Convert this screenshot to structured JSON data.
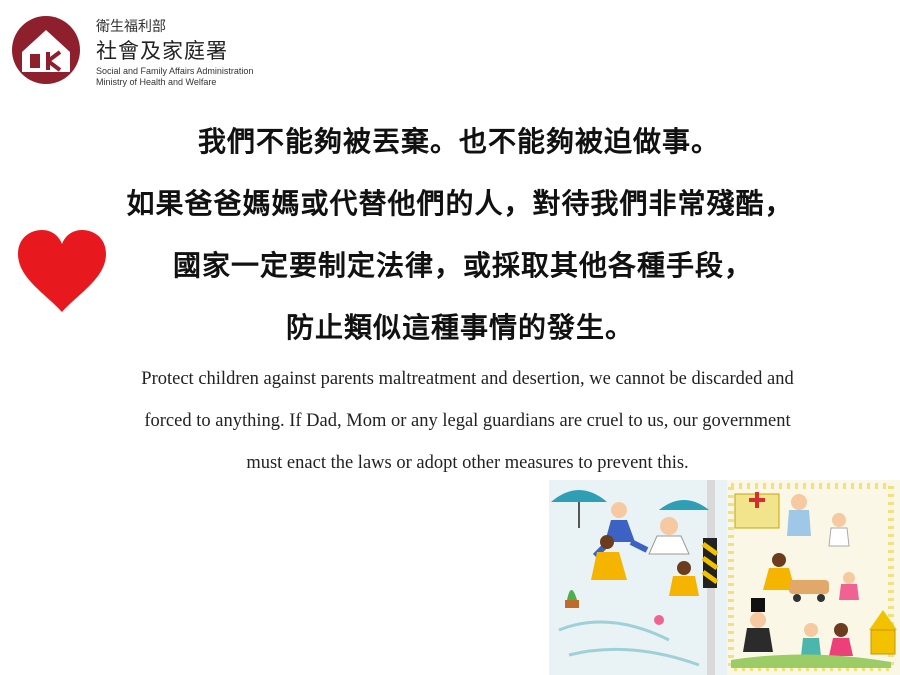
{
  "org": {
    "name_zh_1": "衛生福利部",
    "name_zh_2": "社會及家庭署",
    "name_en_1": "Social and Family Affairs Administration",
    "name_en_2": "Ministry of Health and Welfare",
    "logo_icon": "house-k-logo-icon",
    "brand_color": "#8e1f2c"
  },
  "heading": {
    "line1": "我們不能夠被丟棄。也不能夠被迫做事。",
    "line2": "如果爸爸媽媽或代替他們的人，對待我們非常殘酷，",
    "line3": "國家一定要制定法律，或採取其他各種手段，",
    "line4": "防止類似這種事情的發生。"
  },
  "english": {
    "line1": "Protect children against parents maltreatment and desertion, we cannot be discarded and",
    "line2": "forced to anything. If Dad, Mom or any legal guardians are cruel to us, our government",
    "line3": "must enact the laws or adopt other measures to prevent this."
  },
  "decor": {
    "heart_icon": "heart-icon",
    "heart_color": "#e8191e"
  }
}
